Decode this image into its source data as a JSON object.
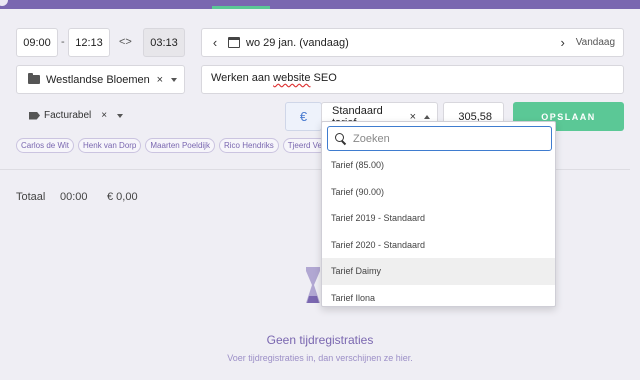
{
  "colors": {
    "accent_purple": "#7a67b0",
    "save_green": "#5bc896",
    "search_focus_blue": "#3f7ccf",
    "background": "#efeef4"
  },
  "time": {
    "start": "09:00",
    "separator": "-",
    "end": "12:13",
    "toggle_icon": "<>",
    "duration": "03:13"
  },
  "date": {
    "prev_icon": "chevron-left-icon",
    "calendar_icon": "calendar-icon",
    "label": "wo 29 jan. (vandaag)",
    "next_icon": "chevron-right-icon",
    "today_label": "Vandaag"
  },
  "project": {
    "icon": "folder-icon",
    "name": "Westlandse Bloemen",
    "clear": "×"
  },
  "description": {
    "prefix": "Werken aan ",
    "misspelled": "website",
    "suffix": " SEO"
  },
  "billable": {
    "icon": "tag-icon",
    "label": "Facturabel",
    "clear": "×"
  },
  "rate": {
    "currency": "€",
    "selected": "Standaard tarief",
    "clear": "×",
    "amount": "305,58"
  },
  "save_label": "OPSLAAN",
  "people": [
    "Carlos de Wit",
    "Henk van Dorp",
    "Maarten Poeldijk",
    "Rico Hendriks",
    "Tjeerd Ve"
  ],
  "totals": {
    "label": "Totaal",
    "time": "00:00",
    "money": "€ 0,00"
  },
  "empty": {
    "icon": "hourglass-icon",
    "title": "Geen tijdregistraties",
    "subtitle": "Voer tijdregistraties in, dan verschijnen ze hier."
  },
  "dropdown": {
    "search_placeholder": "Zoeken",
    "items": [
      "Tarief (85.00)",
      "Tarief (90.00)",
      "Tarief 2019 - Standaard",
      "Tarief 2020 - Standaard",
      "Tarief Daimy",
      "Tarief Ilona"
    ],
    "highlighted_item": "Tarief Daimy"
  }
}
